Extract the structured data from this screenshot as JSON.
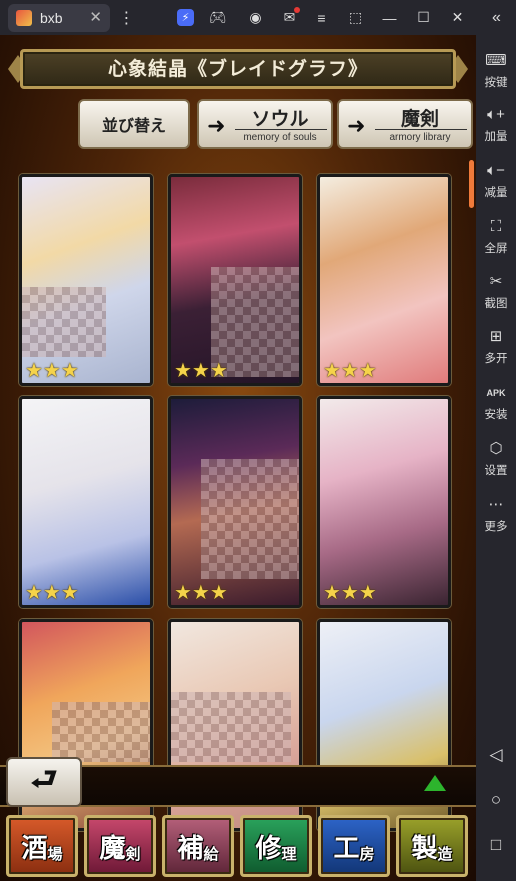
{
  "window": {
    "tab_title": "bxb",
    "close_glyph": "✕"
  },
  "game": {
    "title": "心象結晶《ブレイドグラフ》",
    "sort_label": "並び替え",
    "nav_buttons": [
      {
        "main": "ソウル",
        "sub": "memory of souls"
      },
      {
        "main": "魔剣",
        "sub": "armory library"
      }
    ],
    "cards": [
      {
        "rating": 3,
        "stars": "★★★"
      },
      {
        "rating": 3,
        "stars": "★★★"
      },
      {
        "rating": 3,
        "stars": "★★★"
      },
      {
        "rating": 3,
        "stars": "★★★"
      },
      {
        "rating": 3,
        "stars": "★★★"
      },
      {
        "rating": 3,
        "stars": "★★★"
      },
      {
        "rating": null
      },
      {
        "rating": null
      },
      {
        "rating": null
      }
    ],
    "bottom_menu": [
      {
        "a": "酒",
        "b": "場"
      },
      {
        "a": "魔",
        "b": "剣"
      },
      {
        "a": "補",
        "b": "給"
      },
      {
        "a": "修",
        "b": "理"
      },
      {
        "a": "工",
        "b": "房"
      },
      {
        "a": "製",
        "b": "造"
      }
    ]
  },
  "sidebar": {
    "items": [
      {
        "label": "按键",
        "icon": "keyboard-icon"
      },
      {
        "label": "加量",
        "icon": "volume-up-icon"
      },
      {
        "label": "减量",
        "icon": "volume-down-icon"
      },
      {
        "label": "全屏",
        "icon": "fullscreen-icon"
      },
      {
        "label": "截图",
        "icon": "screenshot-icon"
      },
      {
        "label": "多开",
        "icon": "multi-instance-icon"
      },
      {
        "label": "安装",
        "icon": "apk-install-icon"
      },
      {
        "label": "设置",
        "icon": "settings-icon"
      },
      {
        "label": "更多",
        "icon": "more-icon"
      }
    ]
  },
  "colors": {
    "accent": "#f07a3a",
    "frame_gold": "#c9b26b",
    "star": "#f5d34a",
    "green_arrow": "#2db42d"
  }
}
